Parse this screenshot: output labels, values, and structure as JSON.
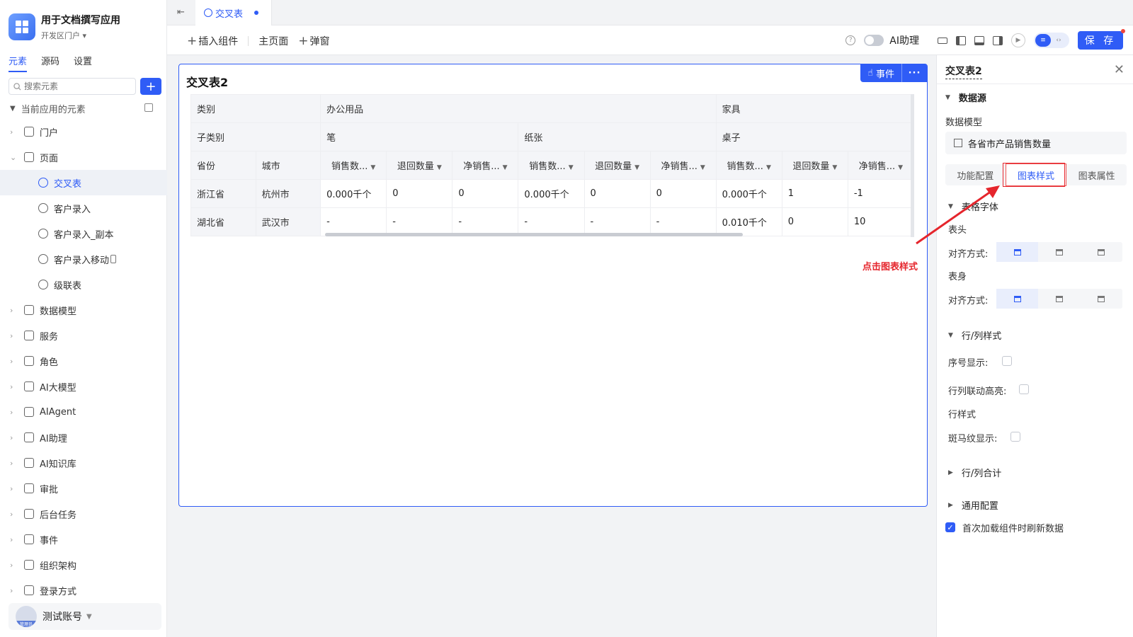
{
  "app": {
    "name": "用于文档撰写应用",
    "portal": "开发区门户"
  },
  "left_tabs": [
    "元素",
    "源码",
    "设置"
  ],
  "search": {
    "placeholder": "搜索元素",
    "add_label": "+"
  },
  "tree": {
    "header": "当前应用的元素",
    "items": [
      {
        "label": "门户",
        "icon": "home-icon"
      },
      {
        "label": "页面",
        "icon": "page-icon",
        "expanded": true
      },
      {
        "label": "交叉表",
        "icon": "table-page-icon",
        "sub": true,
        "selected": true
      },
      {
        "label": "客户录入",
        "icon": "form-page-icon",
        "sub": true
      },
      {
        "label": "客户录入_副本",
        "icon": "form-page-icon",
        "sub": true
      },
      {
        "label": "客户录入移动",
        "icon": "form-page-icon",
        "sub": true,
        "mobile": true
      },
      {
        "label": "级联表",
        "icon": "form-page-icon",
        "sub": true
      },
      {
        "label": "数据模型",
        "icon": "table-icon"
      },
      {
        "label": "服务",
        "icon": "service-icon"
      },
      {
        "label": "角色",
        "icon": "role-icon"
      },
      {
        "label": "AI大模型",
        "icon": "model-icon"
      },
      {
        "label": "AIAgent",
        "icon": "robot-icon"
      },
      {
        "label": "AI助理",
        "icon": "ai-assistant-icon"
      },
      {
        "label": "AI知识库",
        "icon": "book-icon"
      },
      {
        "label": "审批",
        "icon": "stamp-icon"
      },
      {
        "label": "后台任务",
        "icon": "task-icon"
      },
      {
        "label": "事件",
        "icon": "event-icon"
      },
      {
        "label": "组织架构",
        "icon": "org-icon"
      },
      {
        "label": "登录方式",
        "icon": "login-icon"
      }
    ]
  },
  "user": {
    "name": "测试账号",
    "role": "管理员"
  },
  "doc_tab": {
    "label": "交叉表"
  },
  "toolbar": {
    "insert_label": "插入组件",
    "home_label": "主页面",
    "popup_label": "弹窗",
    "ai_label": "AI助理",
    "save_label": "保 存"
  },
  "widget": {
    "title": "交叉表2",
    "event_label": "事件",
    "more_label": "···",
    "row1": {
      "label": "类别",
      "groups": [
        "办公用品",
        "家具"
      ]
    },
    "row2": {
      "label": "子类别",
      "groups": [
        "笔",
        "纸张",
        "桌子"
      ]
    },
    "row3": {
      "province": "省份",
      "city": "城市",
      "metrics": [
        "销售数...",
        "退回数量",
        "净销售...",
        "销售数...",
        "退回数量",
        "净销售...",
        "销售数...",
        "退回数量",
        "净销售..."
      ]
    },
    "rows": [
      {
        "province": "浙江省",
        "city": "杭州市",
        "values": [
          "0.000千个",
          "0",
          "0",
          "0.000千个",
          "0",
          "0",
          "0.000千个",
          "1",
          "-1"
        ]
      },
      {
        "province": "湖北省",
        "city": "武汉市",
        "values": [
          "-",
          "-",
          "-",
          "-",
          "-",
          "-",
          "0.010千个",
          "0",
          "10"
        ]
      }
    ]
  },
  "panel": {
    "title": "交叉表2",
    "datasource_label": "数据源",
    "model_label": "数据模型",
    "model_value": "各省市产品销售数量",
    "tabs": [
      "功能配置",
      "图表样式",
      "图表属性"
    ],
    "font_section": "表格字体",
    "header_label": "表头",
    "align_label": "对齐方式:",
    "body_label": "表身",
    "rowcol_section": "行/列样式",
    "index_label": "序号显示:",
    "highlight_label": "行列联动高亮:",
    "rowstyle_label": "行样式",
    "zebra_label": "斑马纹显示:",
    "total_section": "行/列合计",
    "general_section": "通用配置",
    "refresh_label": "首次加载组件时刷新数据"
  },
  "annotation": {
    "text": "点击图表样式"
  },
  "colors": {
    "accent": "#2f5cf6",
    "annotation": "#e5252c"
  }
}
